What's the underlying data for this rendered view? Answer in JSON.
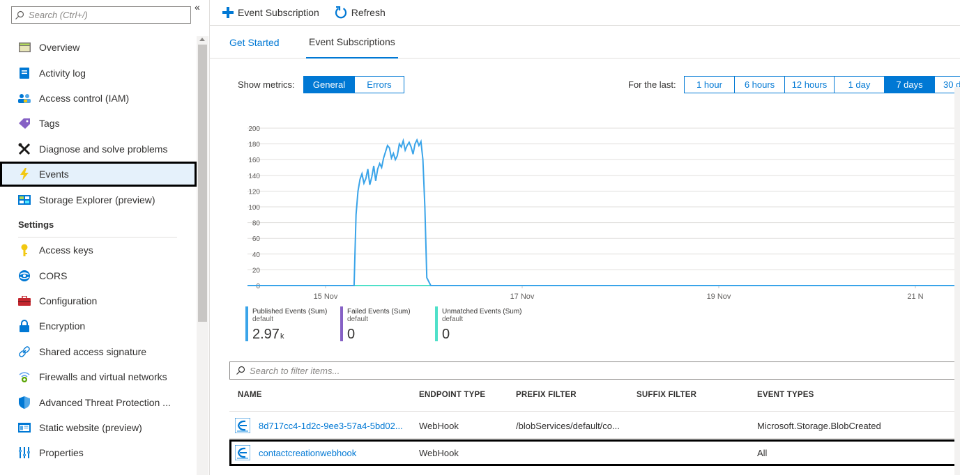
{
  "sidebar": {
    "search_placeholder": "Search (Ctrl+/)",
    "collapse": "«",
    "items": [
      {
        "label": "Overview",
        "icon": "overview-icon"
      },
      {
        "label": "Activity log",
        "icon": "activity-log-icon"
      },
      {
        "label": "Access control (IAM)",
        "icon": "iam-icon"
      },
      {
        "label": "Tags",
        "icon": "tag-icon"
      },
      {
        "label": "Diagnose and solve problems",
        "icon": "wrench-icon"
      },
      {
        "label": "Events",
        "icon": "lightning-icon",
        "selected": true
      },
      {
        "label": "Storage Explorer (preview)",
        "icon": "storage-explorer-icon"
      }
    ],
    "settings_header": "Settings",
    "settings_items": [
      {
        "label": "Access keys",
        "icon": "key-icon"
      },
      {
        "label": "CORS",
        "icon": "cors-icon"
      },
      {
        "label": "Configuration",
        "icon": "configuration-icon"
      },
      {
        "label": "Encryption",
        "icon": "lock-icon"
      },
      {
        "label": "Shared access signature",
        "icon": "link-icon"
      },
      {
        "label": "Firewalls and virtual networks",
        "icon": "firewall-icon"
      },
      {
        "label": "Advanced Threat Protection ...",
        "icon": "shield-icon"
      },
      {
        "label": "Static website (preview)",
        "icon": "static-website-icon"
      },
      {
        "label": "Properties",
        "icon": "properties-icon"
      }
    ]
  },
  "toolbar": {
    "event_subscription_label": "Event Subscription",
    "refresh_label": "Refresh"
  },
  "tabs": {
    "get_started": "Get Started",
    "event_subscriptions": "Event Subscriptions"
  },
  "metrics": {
    "show_label": "Show metrics:",
    "options": [
      "General",
      "Errors"
    ],
    "selected": "General",
    "for_last_label": "For the last:",
    "time_options": [
      "1 hour",
      "6 hours",
      "12 hours",
      "1 day",
      "7 days",
      "30 d"
    ],
    "time_selected": "7 days"
  },
  "chart_data": {
    "type": "line",
    "y_ticks": [
      0,
      20,
      40,
      60,
      80,
      100,
      120,
      140,
      160,
      180,
      200
    ],
    "ylim": [
      0,
      200
    ],
    "x_tick_labels": [
      "15 Nov",
      "17 Nov",
      "19 Nov",
      "21 N"
    ],
    "series": [
      {
        "name": "Published Events (Sum)",
        "color": "#3aa4e9",
        "x_days": [
          0.0,
          1.25,
          1.29,
          1.31,
          1.33,
          1.35,
          1.37,
          1.39,
          1.41,
          1.43,
          1.45,
          1.47,
          1.49,
          1.51,
          1.53,
          1.55,
          1.57,
          1.59,
          1.61,
          1.63,
          1.65,
          1.67,
          1.69,
          1.71,
          1.73,
          1.75,
          1.77,
          1.79,
          1.81,
          1.83,
          1.85,
          1.87,
          1.89,
          1.91,
          1.93,
          1.95,
          1.97,
          1.99,
          2.01,
          2.03,
          2.07,
          6.0
        ],
        "values": [
          0,
          0,
          0,
          90,
          120,
          135,
          142,
          130,
          136,
          148,
          128,
          138,
          152,
          133,
          148,
          155,
          150,
          162,
          170,
          178,
          175,
          162,
          168,
          160,
          165,
          180,
          176,
          184,
          172,
          178,
          182,
          176,
          167,
          180,
          185,
          178,
          183,
          160,
          100,
          10,
          0,
          0
        ]
      },
      {
        "name": "Failed Events (Sum)",
        "color": "#8661c5",
        "values": [
          0
        ]
      },
      {
        "name": "Unmatched Events (Sum)",
        "color": "#4fe0c9",
        "values": [
          0
        ]
      }
    ]
  },
  "legend": [
    {
      "name": "Published Events (Sum)",
      "sub": "default",
      "value": "2.97",
      "unit": "k",
      "color": "#3aa4e9"
    },
    {
      "name": "Failed Events (Sum)",
      "sub": "default",
      "value": "0",
      "unit": "",
      "color": "#8661c5"
    },
    {
      "name": "Unmatched Events (Sum)",
      "sub": "default",
      "value": "0",
      "unit": "",
      "color": "#4fe0c9"
    }
  ],
  "filter_placeholder": "Search to filter items...",
  "table": {
    "headers": [
      "NAME",
      "ENDPOINT TYPE",
      "PREFIX FILTER",
      "SUFFIX FILTER",
      "EVENT TYPES"
    ],
    "rows": [
      {
        "name": "8d717cc4-1d2c-9ee3-57a4-5bd02...",
        "endpoint": "WebHook",
        "prefix": "/blobServices/default/co...",
        "suffix": "",
        "events": "Microsoft.Storage.BlobCreated",
        "highlighted": false
      },
      {
        "name": "contactcreationwebhook",
        "endpoint": "WebHook",
        "prefix": "",
        "suffix": "",
        "events": "All",
        "highlighted": true
      }
    ]
  }
}
